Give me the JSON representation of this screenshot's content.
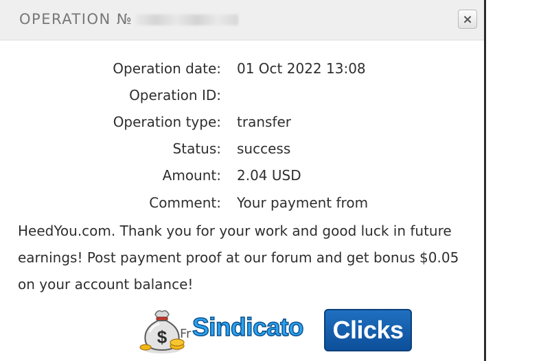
{
  "modal": {
    "title_prefix": "OPERATION №",
    "close_symbol": "×"
  },
  "details": [
    {
      "label": "Operation date:",
      "value": "01 Oct 2022 13:08"
    },
    {
      "label": "Operation ID:",
      "value": ""
    },
    {
      "label": "Operation type:",
      "value": "transfer"
    },
    {
      "label": "Status:",
      "value": "success"
    },
    {
      "label": "Amount:",
      "value": "2.04 USD"
    },
    {
      "label": "Comment:",
      "value": "Your payment from"
    }
  ],
  "comment_continuation": "HeedYou.com. Thank you for your work and good luck in future earnings! Post payment proof at our forum and get bonus $0.05 on your account balance!",
  "banner": {
    "partial_text": "Fr",
    "brand_part1": "Sindicato",
    "brand_part2": "Clicks"
  },
  "colors": {
    "brand_blue": "#2aa3f0",
    "brand_dark_blue": "#0d4f9a",
    "header_bg": "#efefef"
  }
}
